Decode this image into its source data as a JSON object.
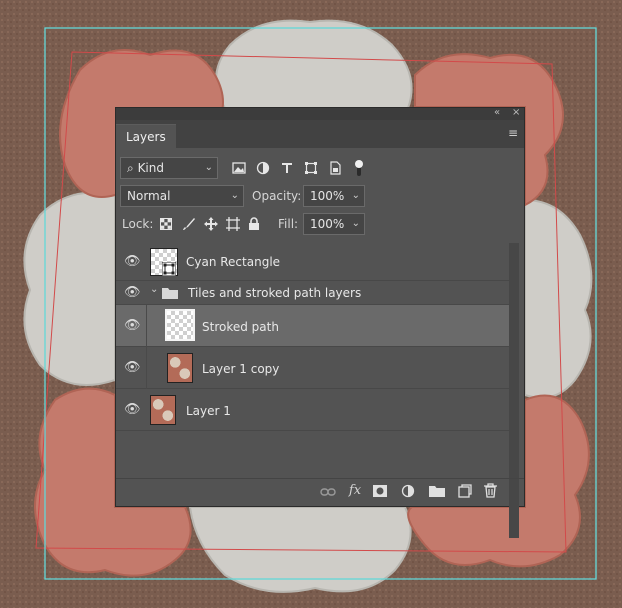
{
  "panel": {
    "collapse_icon": "«",
    "close_icon": "×",
    "tab_label": "Layers",
    "menu_icon": "≡"
  },
  "filter": {
    "search_icon": "⌕",
    "kind_label": "Kind",
    "chevron": "⌄",
    "icons": [
      "image-filter-icon",
      "adjustment-filter-icon",
      "type-filter-icon",
      "shape-filter-icon",
      "smart-object-filter-icon",
      "filter-toggle-icon"
    ]
  },
  "blend": {
    "mode": "Normal",
    "opacity_label": "Opacity:",
    "opacity_value": "100%"
  },
  "lock": {
    "label": "Lock:",
    "fill_label": "Fill:",
    "fill_value": "100%"
  },
  "layers": [
    {
      "name": "Cyan Rectangle",
      "type": "shape"
    },
    {
      "name": "Tiles and stroked path layers",
      "type": "group"
    },
    {
      "name": "Stroked path",
      "type": "layer",
      "selected": true
    },
    {
      "name": "Layer 1 copy",
      "type": "image"
    },
    {
      "name": "Layer 1",
      "type": "image"
    }
  ],
  "footer_icons": [
    "link-layers-icon",
    "fx-icon",
    "add-mask-icon",
    "adjustment-layer-icon",
    "new-group-icon",
    "new-layer-icon",
    "delete-layer-icon"
  ],
  "colors": {
    "canvas_bg": "#7a5d4f",
    "tile_red": "#c47a6c",
    "tile_gray": "#cfcdc8",
    "guide_cyan": "#63d8d8",
    "path_red": "#d24a4a",
    "panel_bg": "#535353",
    "selected_row": "#6a6a6a"
  }
}
